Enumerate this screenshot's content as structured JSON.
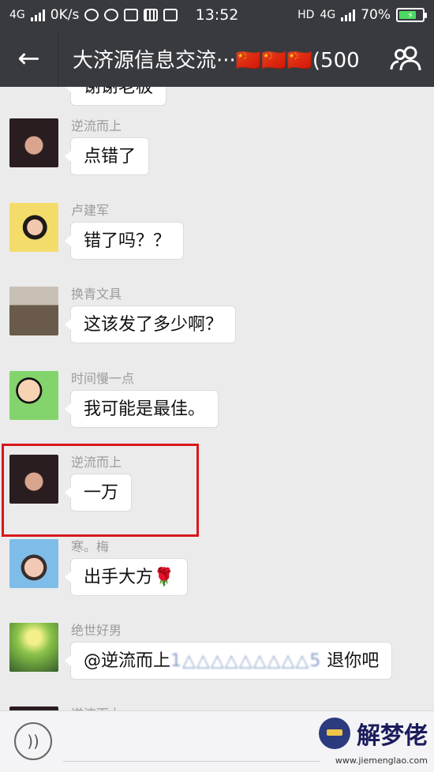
{
  "status_bar": {
    "network": "4G",
    "speed": "0K/s",
    "time": "13:52",
    "hd_label": "HD",
    "network_right": "4G",
    "battery": "70%"
  },
  "header": {
    "title": "大济源信息交流···🇨🇳🇨🇳🇨🇳(500"
  },
  "messages": [
    {
      "name": "",
      "text": "谢谢老板",
      "avatar_color": "#b9a79c"
    },
    {
      "name": "逆流而上",
      "text": "点错了",
      "avatar_color": "#3b2a2c"
    },
    {
      "name": "卢建军",
      "text": "错了吗？？",
      "avatar_color": "#d9c16b"
    },
    {
      "name": "换青文具",
      "text": "这该发了多少啊？",
      "avatar_color": "#7a6d5f"
    },
    {
      "name": "时间慢一点",
      "text": "我可能是最佳。",
      "avatar_color": "#7fcf6c"
    },
    {
      "name": "逆流而上",
      "text": "一万",
      "avatar_color": "#3b2a2c"
    },
    {
      "name": "寒。梅",
      "text": "出手大方🌹",
      "avatar_color": "#7fb8e8"
    },
    {
      "name": "绝世好男",
      "text": "@逆流而上",
      "masked_number": "1△△△△△△△△△5",
      "suffix": " 退你吧",
      "avatar_color": "#6aa047"
    },
    {
      "name": "逆流而上",
      "text": "",
      "avatar_color": "#3b2a2c"
    }
  ],
  "watermark": {
    "text": "解梦佬",
    "url": "www.jiemenglao.com"
  }
}
